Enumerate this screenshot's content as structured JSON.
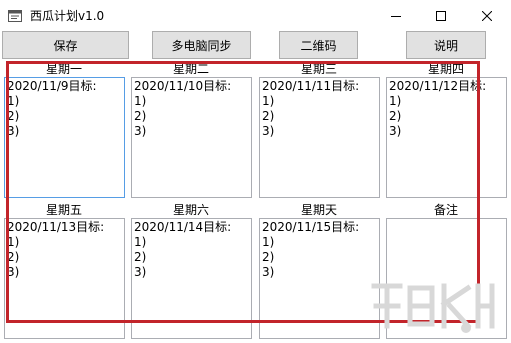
{
  "window": {
    "title": "西瓜计划v1.0"
  },
  "toolbar": {
    "save_label": "保存",
    "sync_label": "多电脑同步",
    "qrcode_label": "二维码",
    "help_label": "说明"
  },
  "days": [
    {
      "label": "星期一",
      "lines": [
        "2020/11/9目标:",
        "1)",
        "2)",
        "3)"
      ]
    },
    {
      "label": "星期二",
      "lines": [
        "2020/11/10目标:",
        "1)",
        "2)",
        "3)"
      ]
    },
    {
      "label": "星期三",
      "lines": [
        "2020/11/11目标:",
        "1)",
        "2)",
        "3)"
      ]
    },
    {
      "label": "星期四",
      "lines": [
        "2020/11/12目标:",
        "1)",
        "2)",
        "3)"
      ]
    },
    {
      "label": "星期五",
      "lines": [
        "2020/11/13目标:",
        "1)",
        "2)",
        "3)"
      ]
    },
    {
      "label": "星期六",
      "lines": [
        "2020/11/14目标:",
        "1)",
        "2)",
        "3)"
      ]
    },
    {
      "label": "星期天",
      "lines": [
        "2020/11/15目标:",
        "1)",
        "2)",
        "3)"
      ]
    }
  ],
  "notes": {
    "label": "备注",
    "lines": []
  },
  "colors": {
    "highlight": "#c2242a",
    "focus_border": "#569de5",
    "button_bg": "#e1e1e1"
  }
}
